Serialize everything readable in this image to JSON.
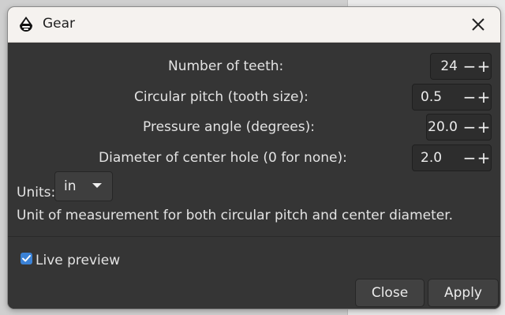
{
  "window": {
    "title": "Gear",
    "close_icon": "close-icon",
    "app_icon": "inkscape-icon"
  },
  "fields": [
    {
      "label": "Number of teeth:",
      "value": "24"
    },
    {
      "label": "Circular pitch (tooth size):",
      "value": "0.5"
    },
    {
      "label": "Pressure angle (degrees):",
      "value": "20.0"
    },
    {
      "label": "Diameter of center hole (0 for none):",
      "value": "2.0"
    }
  ],
  "spin_buttons": {
    "minus": "−",
    "plus": "+"
  },
  "units": {
    "label": "Units:",
    "selected": "in",
    "description": "Unit of measurement for both circular pitch and center diameter."
  },
  "live_preview": {
    "label": "Live preview",
    "checked": true
  },
  "buttons": {
    "close": "Close",
    "apply": "Apply"
  },
  "colors": {
    "accent": "#3b82d6",
    "dialog_bg": "#353535",
    "titlebar_bg": "#f5f2ef"
  }
}
